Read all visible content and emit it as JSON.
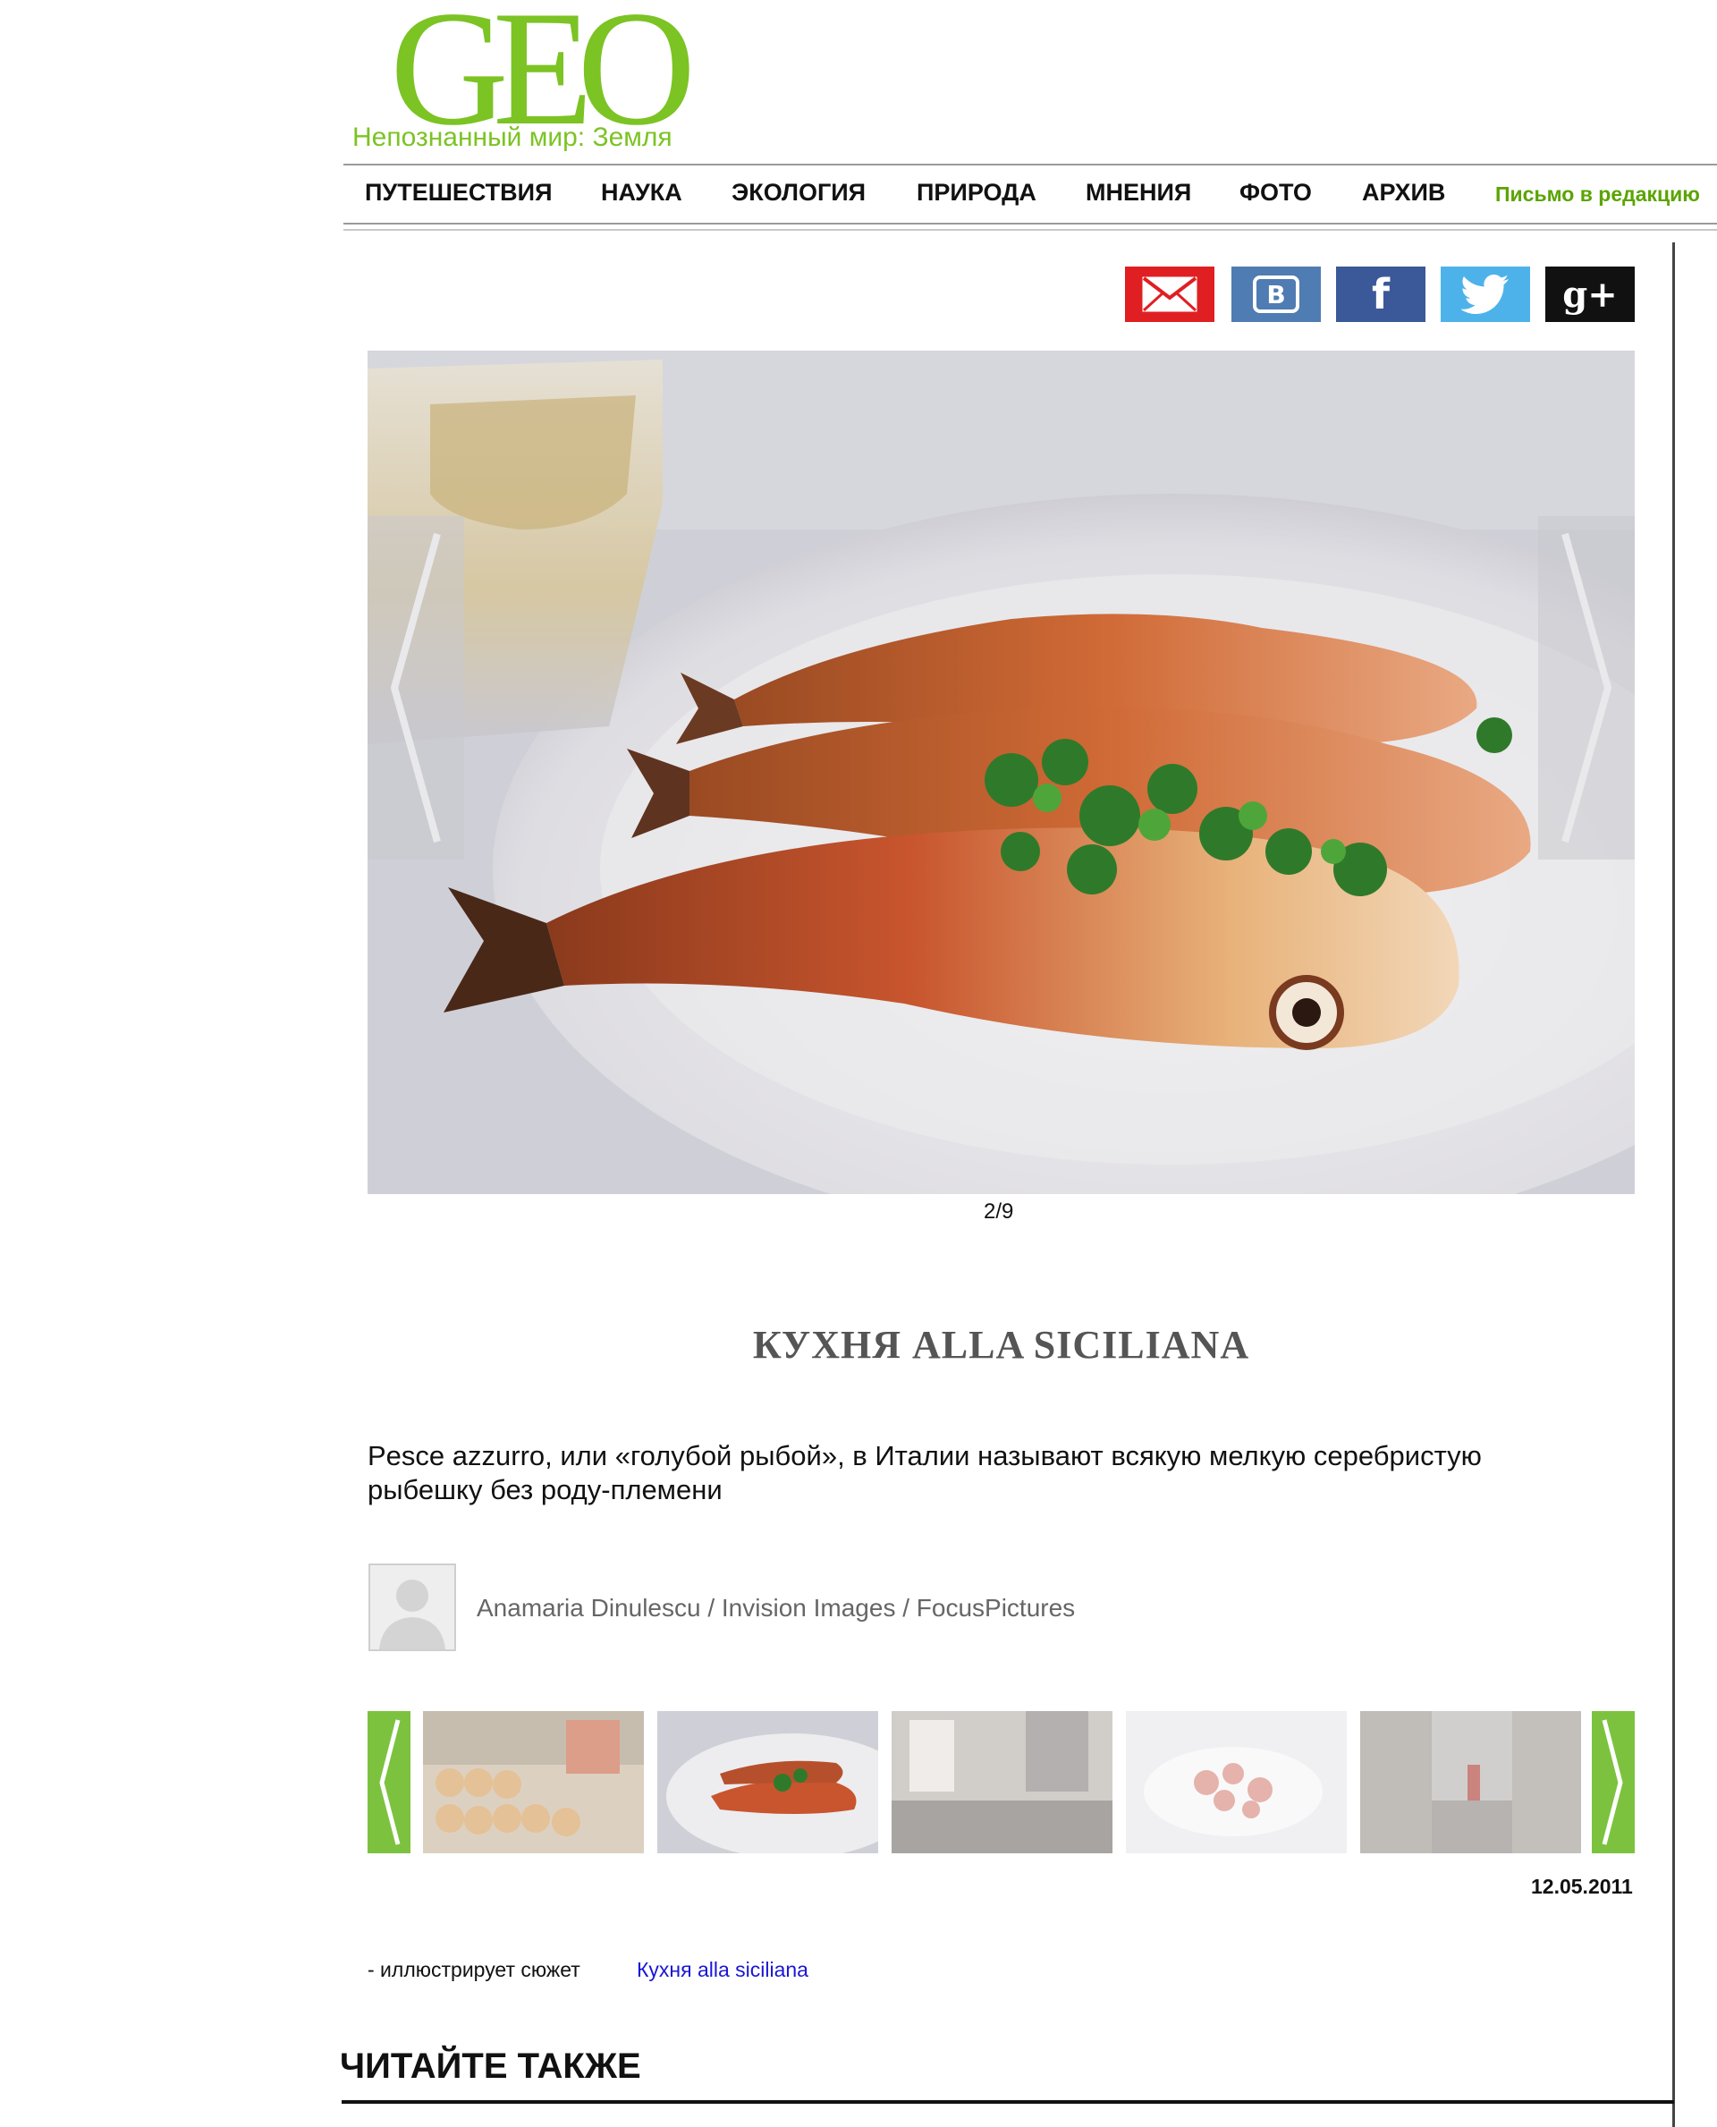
{
  "logo": {
    "wordmark": "GEO",
    "tagline": "Непознанный мир: Земля"
  },
  "nav": {
    "items": [
      "ПУТЕШЕСТВИЯ",
      "НАУКА",
      "ЭКОЛОГИЯ",
      "ПРИРОДА",
      "МНЕНИЯ",
      "ФОТО",
      "АРХИВ"
    ],
    "letter_link": "Письмо в редакцию"
  },
  "share": {
    "vk": "В",
    "fb": "f",
    "gplus": "g+"
  },
  "gallery": {
    "counter": "2/9",
    "title": "КУХНЯ ALLA SICILIANA",
    "lead": "Pesce azzurro, или «голубой рыбой», в Италии называют всякую мелкую серебристую рыбешку без роду-племени",
    "credit": "Anamaria Dinulescu / Invision Images / FocusPictures",
    "date": "12.05.2011"
  },
  "story": {
    "prefix": "- иллюстрирует сюжет",
    "link": "Кухня alla siciliana"
  },
  "read_also": "ЧИТАЙТЕ ТАКЖЕ",
  "colors": {
    "brand_green": "#7cc324",
    "nav_green": "#5aa400",
    "link_blue": "#1a16d6"
  }
}
